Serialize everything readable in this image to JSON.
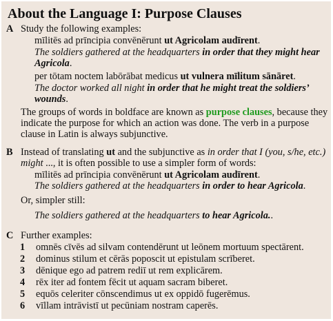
{
  "title": "About the Language I: Purpose Clauses",
  "sectionA": {
    "label": "A",
    "intro": "Study the following examples:",
    "ex1": {
      "latin": "mīlitēs ad prīncipia convēnērunt ",
      "latin_bold": "ut Agricolam audīrent",
      "end": ".",
      "eng": "The soldiers gathered at the headquarters ",
      "eng_bold1": "in order that they might hear",
      "eng_bold2": "Agricola",
      "eng_end": "."
    },
    "ex2": {
      "latin": "per tōtam noctem labōrābat medicus ",
      "latin_bold": "ut vulnera mīlitum sānāret",
      "end": ".",
      "eng": "The doctor worked all night ",
      "eng_bold1": "in order that he might treat the soldiers’",
      "eng_bold2": "wounds",
      "eng_end": "."
    },
    "para": {
      "l1a": "The groups of words in boldface are known as ",
      "highlight": "purpose clauses",
      "l1b": ", because they",
      "l2": "indicate the purpose for which an action was done. The verb in a purpose",
      "l3": "clause in Latin is always subjunctive."
    },
    "highlight_color": "#1e9a1e"
  },
  "sectionB": {
    "label": "B",
    "l1a": "Instead of translating ",
    "l1b": "ut",
    "l1c": " and the subjunctive as ",
    "l1d": "in order that I (you, s/he, etc.)",
    "l2a": "might",
    "l2b": " ..., it is often possible to use a simpler form of words:",
    "latin": "mīlitēs ad prīncipia convēnērunt ",
    "latin_bold": "ut Agricolam audīrent",
    "end": ".",
    "eng": "The soldiers gathered at the headquarters ",
    "eng_bold": "in order to hear Agricola",
    "eng_end": ".",
    "simpler": "Or, simpler still:",
    "eng2": "The soldiers gathered at the headquarters ",
    "eng2_bold": "to hear Agricola.",
    "eng2_end": "."
  },
  "sectionC": {
    "label": "C",
    "intro": "Further examples:",
    "items": [
      {
        "n": "1",
        "text": "omnēs cīvēs ad silvam contendērunt ut leōnem mortuum spectārent."
      },
      {
        "n": "2",
        "text": "dominus stilum et cērās poposcit ut epistulam scrīberet."
      },
      {
        "n": "3",
        "text": "dēnique ego ad patrem rediī ut rem explicārem."
      },
      {
        "n": "4",
        "text": "rēx iter ad fontem fēcit ut aquam sacram biberet."
      },
      {
        "n": "5",
        "text": "equōs celeriter cōnscendimus ut ex oppidō fugerēmus."
      },
      {
        "n": "6",
        "text": "vīllam intrāvistī ut pecūniam nostram caperēs."
      }
    ]
  }
}
